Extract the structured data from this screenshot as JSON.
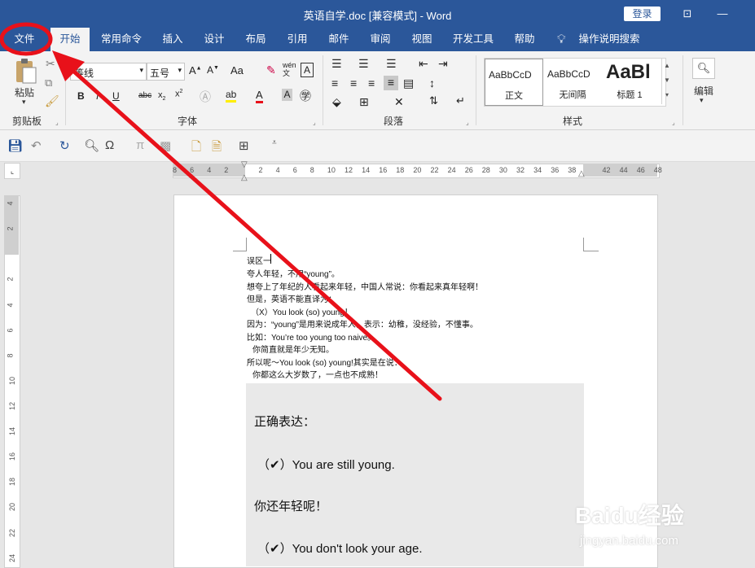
{
  "titlebar": {
    "title": "英语自学.doc [兼容模式] - Word",
    "login_label": "登录"
  },
  "tabs": [
    "文件",
    "开始",
    "常用命令",
    "插入",
    "设计",
    "布局",
    "引用",
    "邮件",
    "审阅",
    "视图",
    "开发工具",
    "帮助"
  ],
  "tell_me": "操作说明搜索",
  "ribbon": {
    "clipboard": {
      "paste_label": "粘贴",
      "group_label": "剪贴板"
    },
    "font": {
      "font_name": "等线",
      "font_size": "五号",
      "group_label": "字体",
      "aa_label": "Aa"
    },
    "paragraph": {
      "group_label": "段落"
    },
    "styles": {
      "group_label": "样式",
      "items": [
        {
          "preview": "AaBbCcD",
          "name": "正文"
        },
        {
          "preview": "AaBbCcD",
          "name": "无间隔"
        },
        {
          "preview": "AaBl",
          "name": "标题 1"
        }
      ]
    },
    "editing": {
      "label": "编辑"
    }
  },
  "ruler": {
    "ticks": [
      "8",
      "6",
      "4",
      "2",
      "",
      "2",
      "4",
      "6",
      "8",
      "10",
      "12",
      "14",
      "16",
      "18",
      "20",
      "22",
      "24",
      "26",
      "28",
      "30",
      "32",
      "34",
      "36",
      "38",
      "",
      "42",
      "44",
      "46",
      "48"
    ],
    "vticks": [
      "4",
      "2",
      "2",
      "4",
      "6",
      "8",
      "10",
      "12",
      "14",
      "16",
      "18",
      "20",
      "22",
      "24"
    ]
  },
  "document": {
    "lines": [
      "误区一",
      "夸人年轻，不用“young”。",
      "想夸上了年纪的人看起来年轻，中国人常说：你看起来真年轻啊！",
      "但是，英语不能直译为：",
      "（X）You look (so) young！",
      "因为：“young”是用来说成年人，表示：幼稚，没经验，不懂事。",
      "比如：You’re too young too naive。",
      "      你简直就是年少无知。",
      "所以呢～You look (so) young!其实是在说：",
      "      你都这么大岁数了，一点也不成熟！"
    ],
    "quote": {
      "heading": "正确表达：",
      "ex1": "（✔）You are still young.",
      "cn1": "你还年轻呢！",
      "ex2": "（✔）You don't look your age."
    }
  },
  "watermark": {
    "brand": "Baidu经验",
    "url": "jingyan.baidu.com"
  },
  "colors": {
    "accent": "#2b579a",
    "annotation": "#e8111a"
  }
}
